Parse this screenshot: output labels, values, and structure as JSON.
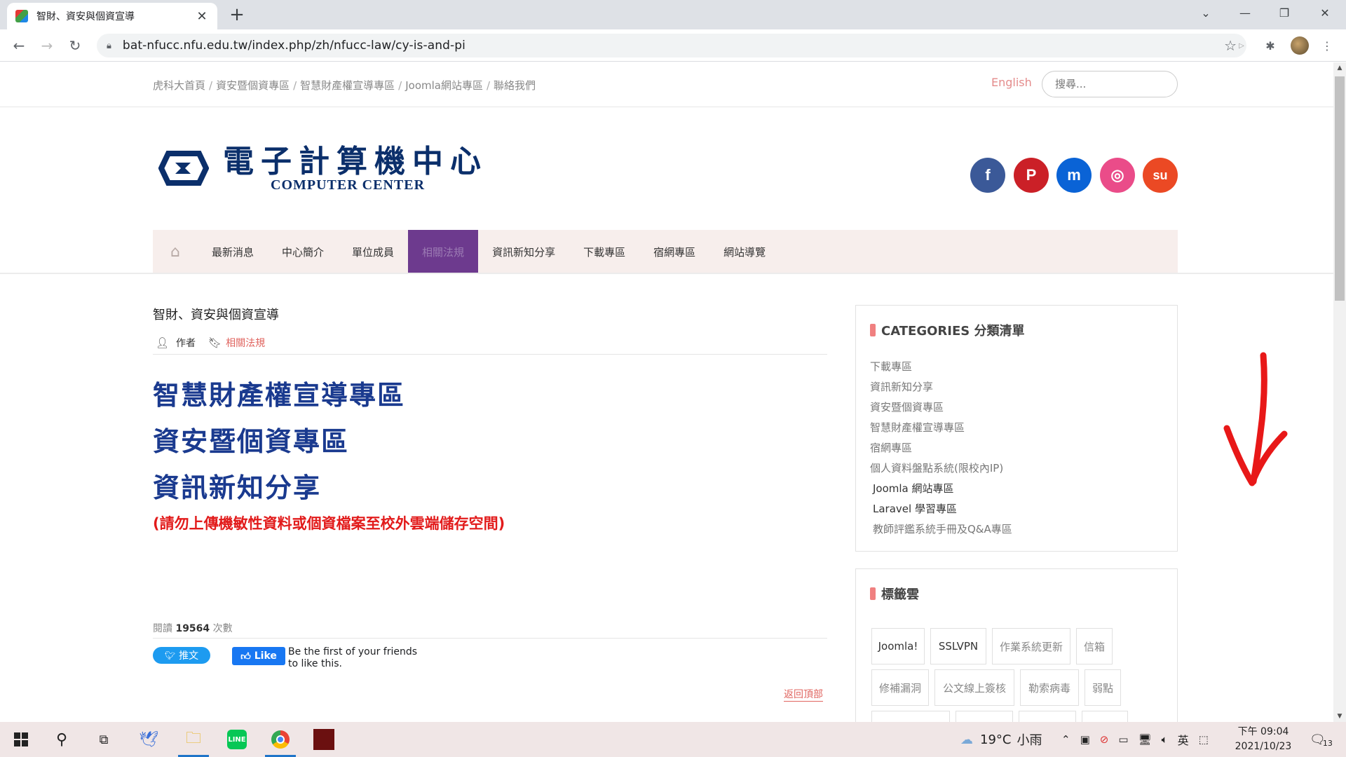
{
  "browser": {
    "tab_title": "智財、資安與個資宣導",
    "tab_close": "✕",
    "new_tab": "+",
    "url": "bat-nfucc.nfu.edu.tw/index.php/zh/nfucc-law/cy-is-and-pi"
  },
  "topbar": {
    "links": [
      "虎科大首頁",
      "資安暨個資專區",
      "智慧財產權宣導專區",
      "Joomla網站專區",
      "聯絡我們"
    ],
    "separator": "/",
    "language": "English",
    "search_placeholder": "搜尋..."
  },
  "logo": {
    "cn": "電子計算機中心",
    "en": "COMPUTER CENTER"
  },
  "social": [
    {
      "name": "facebook",
      "glyph": "f",
      "color": "#3b5998"
    },
    {
      "name": "pinterest",
      "glyph": "P",
      "color": "#cb2027"
    },
    {
      "name": "myspace",
      "glyph": "m",
      "color": "#0a63d6"
    },
    {
      "name": "dribbble",
      "glyph": "◎",
      "color": "#ea4c89"
    },
    {
      "name": "stumbleupon",
      "glyph": "su",
      "color": "#eb4924"
    }
  ],
  "nav": {
    "items": [
      "最新消息",
      "中心簡介",
      "單位成員",
      "相關法規",
      "資訊新知分享",
      "下載專區",
      "宿網專區",
      "網站導覽"
    ],
    "active": "相關法規"
  },
  "article": {
    "title": "智財、資安與個資宣導",
    "author_label": "作者",
    "category": "相關法規",
    "headings": [
      "智慧財產權宣導專區",
      "資安暨個資專區",
      "資訊新知分享"
    ],
    "warning": "(請勿上傳機敏性資料或個資檔案至校外雲端儲存空間)",
    "hits_label": "閱讀",
    "hits_value": "19564",
    "hits_unit": "次數",
    "tweet_label": "推文",
    "like_label": "Like",
    "like_text": "Be the first of your friends to like this.",
    "back_to_top": "返回頂部"
  },
  "sidebar": {
    "categories_title": "CATEGORIES 分類清單",
    "categories": [
      "下載專區",
      "資訊新知分享",
      "資安暨個資專區",
      "智慧財產權宣導專區",
      "宿網專區",
      "個人資料盤點系統(限校內IP)",
      "Joomla 網站專區",
      "Laravel 學習專區",
      "教師評鑑系統手冊及Q&A專區"
    ],
    "tags_title": "標籤雲",
    "tags": [
      "Joomla!",
      "SSLVPN",
      "作業系統更新",
      "信箱",
      "修補漏洞",
      "公文線上簽核",
      "勒索病毒",
      "弱點"
    ]
  },
  "taskbar": {
    "weather_temp": "19°C",
    "weather_text": "小雨",
    "ime": "英",
    "time": "下午 09:04",
    "date": "2021/10/23",
    "notifications": "13"
  },
  "colors": {
    "nav_active": "#6d3a8e",
    "heading_blue": "#1a3a8f",
    "warning_red": "#e21b1b",
    "accent_pink": "#e0645f"
  }
}
